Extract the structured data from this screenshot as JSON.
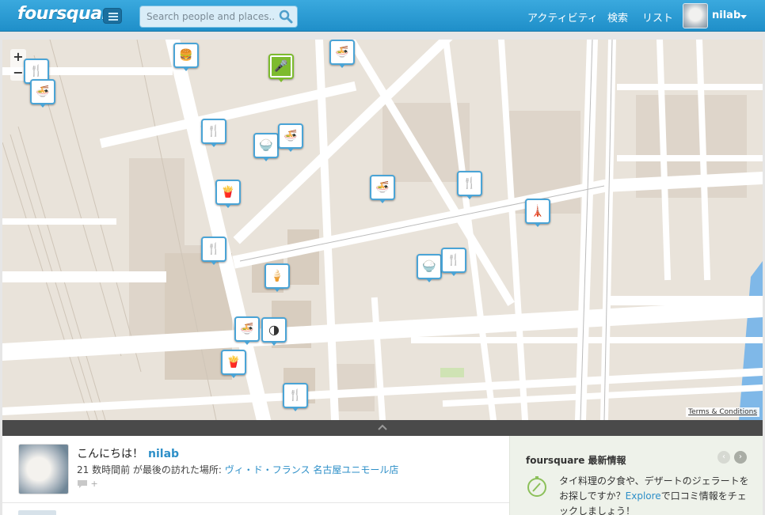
{
  "header": {
    "logo": "foursquare",
    "search_placeholder": "Search people and places...",
    "nav": [
      "アクティビティ",
      "検索",
      "リスト"
    ],
    "username": "nilab"
  },
  "map": {
    "zoom_in": "+",
    "zoom_out": "−",
    "terms": "Terms & Conditions",
    "pins": [
      {
        "icon": "burger-icon",
        "glyph": "🍔"
      },
      {
        "icon": "microphone-icon",
        "glyph": "🎤"
      },
      {
        "icon": "noodle-icon",
        "glyph": "🍜"
      },
      {
        "icon": "cutlery-icon",
        "glyph": "🍴"
      },
      {
        "icon": "noodle-icon",
        "glyph": "🍜"
      },
      {
        "icon": "rice-bowl-icon",
        "glyph": "🍚"
      },
      {
        "icon": "noodle-icon",
        "glyph": "🍜"
      },
      {
        "icon": "cutlery-icon",
        "glyph": "🍴"
      },
      {
        "icon": "fries-icon",
        "glyph": "🍟"
      },
      {
        "icon": "ramen-icon",
        "glyph": "🍜"
      },
      {
        "icon": "cutlery-icon",
        "glyph": "🍴"
      },
      {
        "icon": "tower-icon",
        "glyph": "🗼"
      },
      {
        "icon": "cutlery-icon",
        "glyph": "🍴"
      },
      {
        "icon": "rice-bowl-icon",
        "glyph": "🍚"
      },
      {
        "icon": "cutlery-icon",
        "glyph": "🍴"
      },
      {
        "icon": "ice-cream-icon",
        "glyph": "🍦"
      },
      {
        "icon": "noodle-icon",
        "glyph": "🍜"
      },
      {
        "icon": "cafe-icon",
        "glyph": "◑"
      },
      {
        "icon": "fries-icon",
        "glyph": "🍟"
      },
      {
        "icon": "cutlery-icon",
        "glyph": "🍴"
      }
    ]
  },
  "activity": {
    "greeting": "こんにちは！",
    "username": "nilab",
    "last_visit_prefix": "21 数時間前 が最後の訪れた場所:",
    "last_visit_place": "ヴィ・ド・フランス 名古屋ユニモール店",
    "comment_plus": "+"
  },
  "news": {
    "title": "foursquare 最新情報",
    "prev": "‹",
    "next": "›",
    "text_before": "タイ料理の夕食や、デザートのジェラートをお探しですか？",
    "link": "Explore",
    "text_after": "で口コミ情報をチェックしましょう！"
  },
  "colors": {
    "header": "#2a9bd4",
    "pin_border": "#4aa4d6",
    "pin_green": "#7dbb2e",
    "link": "#2d8fc8"
  }
}
